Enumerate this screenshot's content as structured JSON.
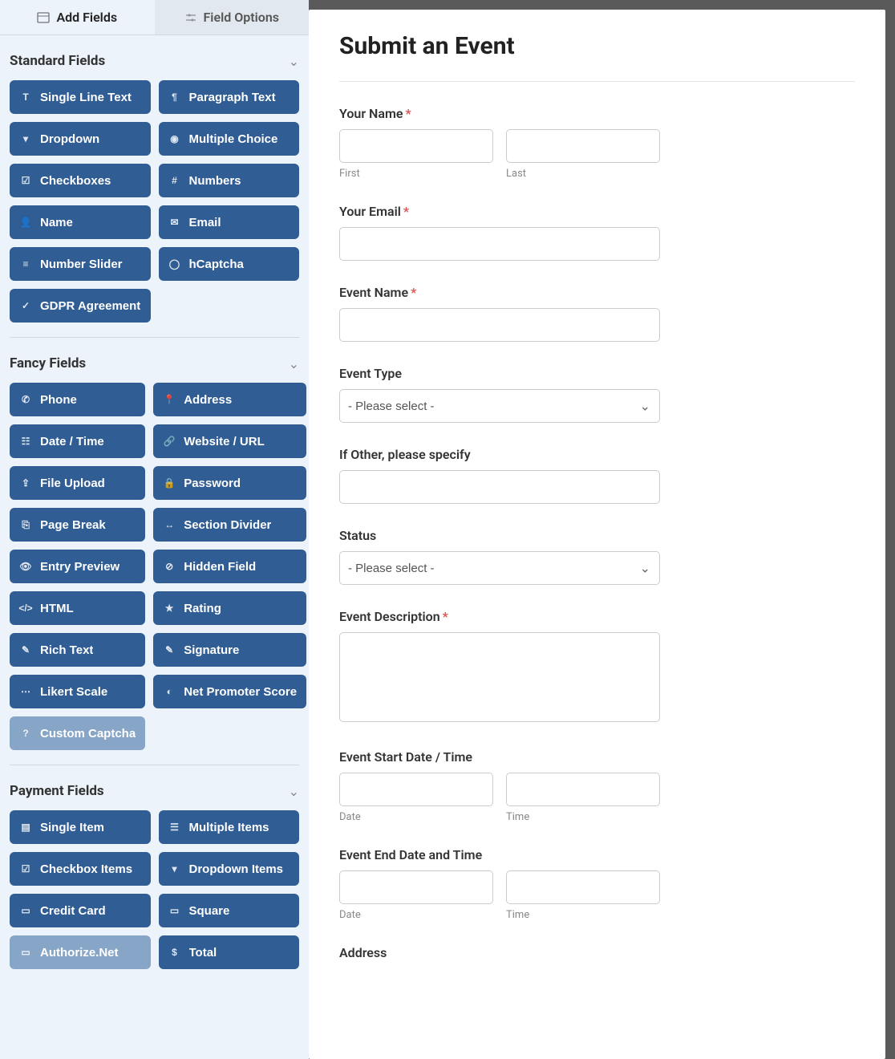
{
  "tabs": {
    "add_fields": "Add Fields",
    "field_options": "Field Options"
  },
  "sections": {
    "standard": {
      "title": "Standard Fields",
      "items": [
        {
          "name": "single-line-text",
          "label": "Single Line Text",
          "icon": "text"
        },
        {
          "name": "paragraph-text",
          "label": "Paragraph Text",
          "icon": "paragraph"
        },
        {
          "name": "dropdown",
          "label": "Dropdown",
          "icon": "caret-square"
        },
        {
          "name": "multiple-choice",
          "label": "Multiple Choice",
          "icon": "radio"
        },
        {
          "name": "checkboxes",
          "label": "Checkboxes",
          "icon": "check-square"
        },
        {
          "name": "numbers",
          "label": "Numbers",
          "icon": "hash"
        },
        {
          "name": "name",
          "label": "Name",
          "icon": "user"
        },
        {
          "name": "email",
          "label": "Email",
          "icon": "envelope"
        },
        {
          "name": "number-slider",
          "label": "Number Slider",
          "icon": "sliders"
        },
        {
          "name": "hcaptcha",
          "label": "hCaptcha",
          "icon": "shield"
        },
        {
          "name": "gdpr-agreement",
          "label": "GDPR Agreement",
          "icon": "check-badge"
        }
      ]
    },
    "fancy": {
      "title": "Fancy Fields",
      "items": [
        {
          "name": "phone",
          "label": "Phone",
          "icon": "phone"
        },
        {
          "name": "address",
          "label": "Address",
          "icon": "pin"
        },
        {
          "name": "date-time",
          "label": "Date / Time",
          "icon": "calendar"
        },
        {
          "name": "website-url",
          "label": "Website / URL",
          "icon": "link"
        },
        {
          "name": "file-upload",
          "label": "File Upload",
          "icon": "upload"
        },
        {
          "name": "password",
          "label": "Password",
          "icon": "lock"
        },
        {
          "name": "page-break",
          "label": "Page Break",
          "icon": "page"
        },
        {
          "name": "section-divider",
          "label": "Section Divider",
          "icon": "arrows-h"
        },
        {
          "name": "entry-preview",
          "label": "Entry Preview",
          "icon": "eye"
        },
        {
          "name": "hidden-field",
          "label": "Hidden Field",
          "icon": "eye-slash"
        },
        {
          "name": "html",
          "label": "HTML",
          "icon": "code"
        },
        {
          "name": "rating",
          "label": "Rating",
          "icon": "star"
        },
        {
          "name": "rich-text",
          "label": "Rich Text",
          "icon": "pencil"
        },
        {
          "name": "signature",
          "label": "Signature",
          "icon": "pen"
        },
        {
          "name": "likert-scale",
          "label": "Likert Scale",
          "icon": "dots"
        },
        {
          "name": "net-promoter-score",
          "label": "Net Promoter Score",
          "icon": "gauge"
        },
        {
          "name": "custom-captcha",
          "label": "Custom Captcha",
          "icon": "question",
          "disabled": true
        }
      ]
    },
    "payment": {
      "title": "Payment Fields",
      "items": [
        {
          "name": "single-item",
          "label": "Single Item",
          "icon": "file"
        },
        {
          "name": "multiple-items",
          "label": "Multiple Items",
          "icon": "list"
        },
        {
          "name": "checkbox-items",
          "label": "Checkbox Items",
          "icon": "check-square"
        },
        {
          "name": "dropdown-items",
          "label": "Dropdown Items",
          "icon": "caret-square"
        },
        {
          "name": "credit-card",
          "label": "Credit Card",
          "icon": "card"
        },
        {
          "name": "square",
          "label": "Square",
          "icon": "card"
        },
        {
          "name": "authorize-net",
          "label": "Authorize.Net",
          "icon": "card",
          "disabled": true
        },
        {
          "name": "total",
          "label": "Total",
          "icon": "money"
        }
      ]
    }
  },
  "form": {
    "title": "Submit an Event",
    "your_name": {
      "label": "Your Name",
      "required": true,
      "first": "First",
      "last": "Last"
    },
    "your_email": {
      "label": "Your Email",
      "required": true
    },
    "event_name": {
      "label": "Event Name",
      "required": true
    },
    "event_type": {
      "label": "Event Type",
      "placeholder": "- Please select -"
    },
    "if_other": {
      "label": "If Other, please specify"
    },
    "status": {
      "label": "Status",
      "placeholder": "- Please select -"
    },
    "event_description": {
      "label": "Event Description",
      "required": true
    },
    "start": {
      "label": "Event Start Date / Time",
      "date": "Date",
      "time": "Time"
    },
    "end": {
      "label": "Event End Date and Time",
      "date": "Date",
      "time": "Time"
    },
    "address": {
      "label": "Address"
    }
  },
  "icons": {
    "text": "T",
    "paragraph": "¶",
    "caret-square": "▾",
    "radio": "◉",
    "check-square": "☑",
    "hash": "#",
    "user": "👤",
    "envelope": "✉",
    "sliders": "≡",
    "shield": "◯",
    "check-badge": "✓",
    "phone": "✆",
    "pin": "📍",
    "calendar": "☷",
    "link": "🔗",
    "upload": "⇪",
    "lock": "🔒",
    "page": "⎘",
    "arrows-h": "↔",
    "eye": "👁",
    "eye-slash": "⊘",
    "code": "</>",
    "star": "★",
    "pencil": "✎",
    "pen": "✎",
    "dots": "⋯",
    "gauge": "◐",
    "question": "?",
    "file": "▤",
    "list": "☰",
    "card": "▭",
    "money": "$"
  }
}
